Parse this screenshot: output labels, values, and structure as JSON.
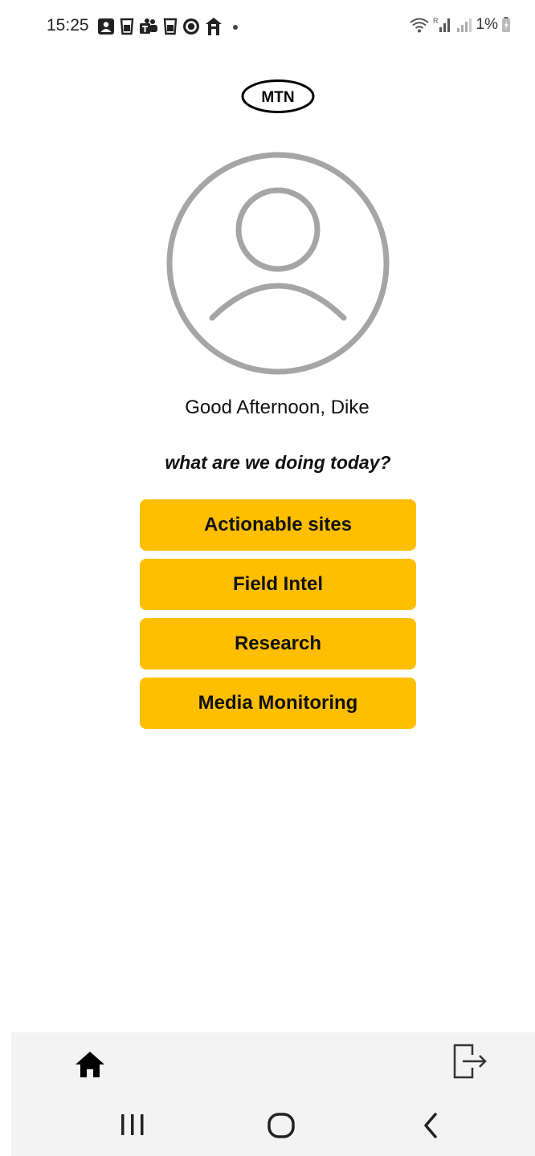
{
  "status_bar": {
    "time": "15:25",
    "battery_text": "1%",
    "left_icons": [
      "contact-card-icon",
      "cup-icon",
      "teams-icon",
      "cup-icon",
      "circle-app-icon",
      "home-app-icon",
      "dot-icon"
    ],
    "right_icons": [
      "wifi-icon",
      "signal-icon",
      "signal-weak-icon",
      "battery-icon"
    ]
  },
  "logo": {
    "text": "MTN"
  },
  "avatar": {
    "icon": "user-avatar-icon",
    "color": "#A5A5A8"
  },
  "greeting": "Good Afternoon, Dike",
  "prompt": "what are we doing today?",
  "menu": {
    "accent_color": "#FFBE00",
    "items": [
      {
        "label": "Actionable sites"
      },
      {
        "label": "Field Intel"
      },
      {
        "label": "Research"
      },
      {
        "label": "Media Monitoring"
      }
    ]
  },
  "bottom_nav": {
    "items": [
      {
        "icon": "home-icon"
      },
      {
        "icon": "logout-icon"
      }
    ]
  },
  "system_nav": {
    "items": [
      {
        "icon": "recent-apps-icon"
      },
      {
        "icon": "home-circle-icon"
      },
      {
        "icon": "back-icon"
      }
    ]
  }
}
